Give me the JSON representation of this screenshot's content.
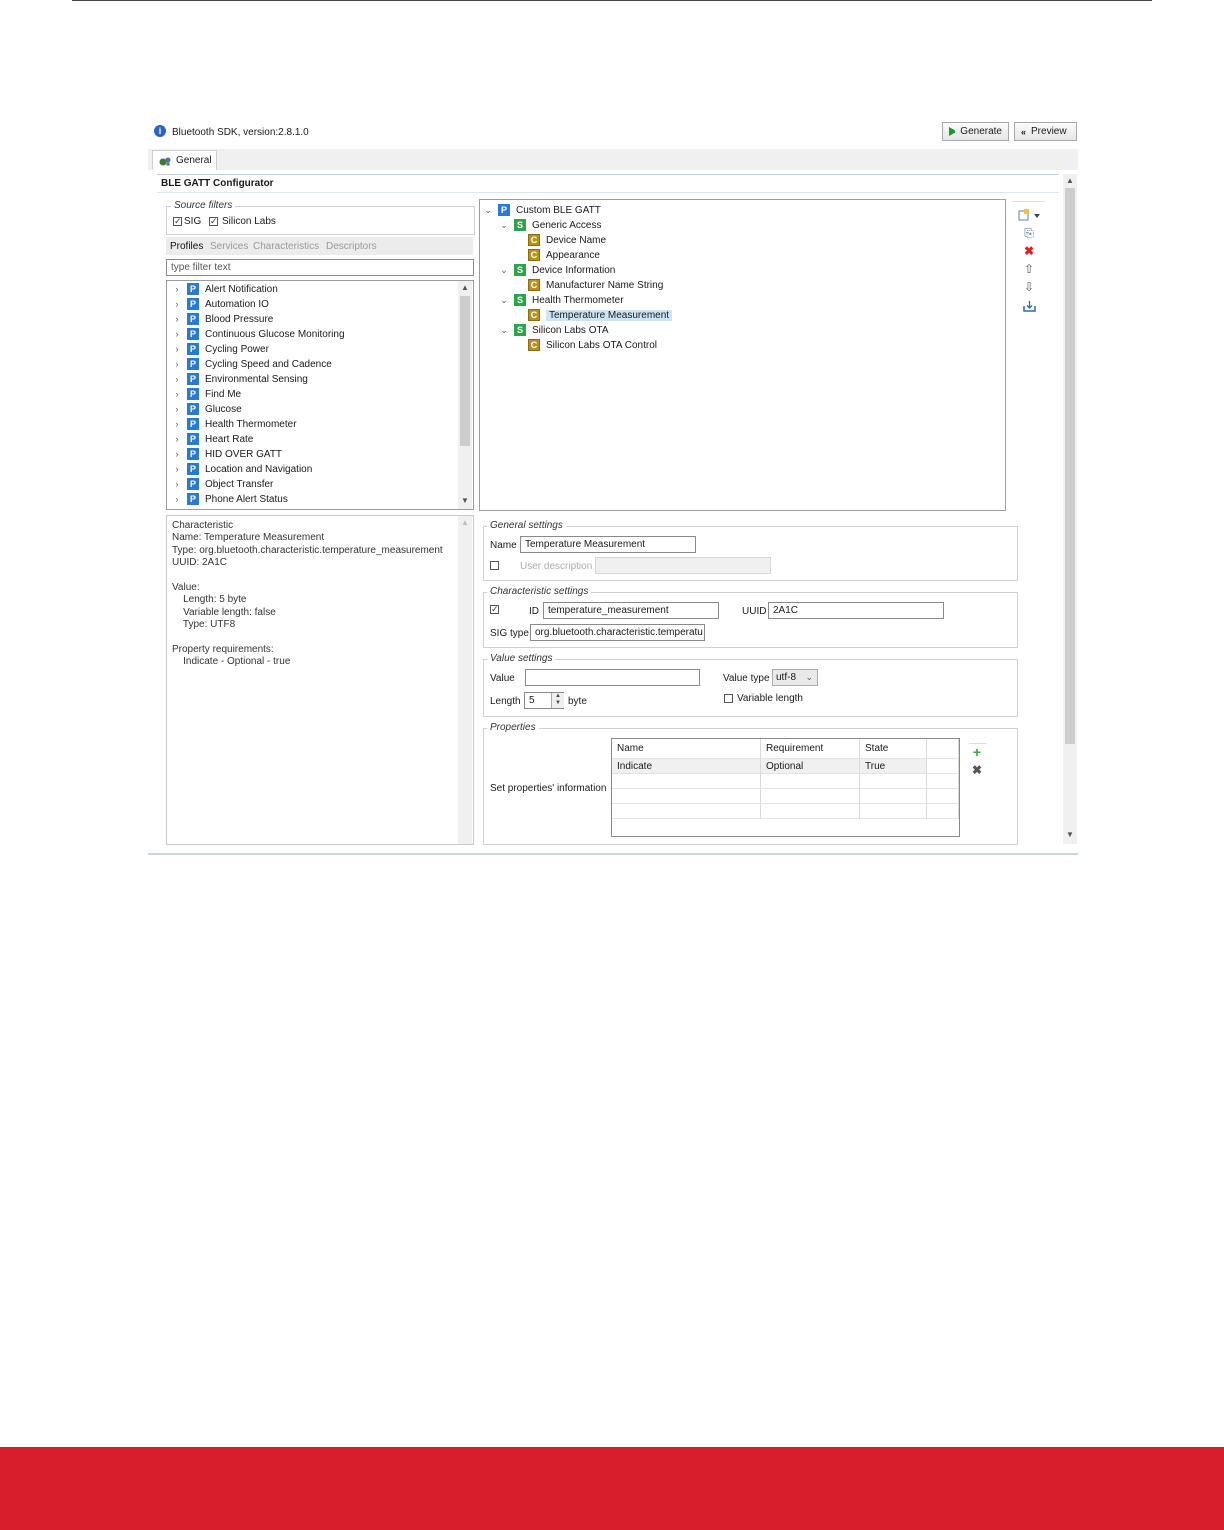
{
  "app": {
    "sdk_label": "Bluetooth SDK, version:2.8.1.0",
    "generate_label": "Generate",
    "preview_label": "Preview",
    "tab_general": "General",
    "section_title": "BLE GATT Configurator"
  },
  "source_filters": {
    "legend": "Source filters",
    "sig_label": "SIG",
    "silabs_label": "Silicon Labs"
  },
  "lib_tabs": [
    "Profiles",
    "Services",
    "Characteristics",
    "Descriptors"
  ],
  "filter": {
    "placeholder": "type filter text"
  },
  "profiles": [
    "Alert Notification",
    "Automation IO",
    "Blood Pressure",
    "Continuous Glucose Monitoring",
    "Cycling Power",
    "Cycling Speed and Cadence",
    "Environmental Sensing",
    "Find Me",
    "Glucose",
    "Health Thermometer",
    "Heart Rate",
    "HID OVER GATT",
    "Location and Navigation",
    "Object Transfer",
    "Phone Alert Status"
  ],
  "profile_badge": "P",
  "gatt_tree": {
    "root": "Custom BLE GATT",
    "nodes": [
      {
        "type": "S",
        "label": "Generic Access",
        "level": 1
      },
      {
        "type": "C",
        "label": "Device Name",
        "level": 2
      },
      {
        "type": "C",
        "label": "Appearance",
        "level": 2
      },
      {
        "type": "S",
        "label": "Device Information",
        "level": 1
      },
      {
        "type": "C",
        "label": "Manufacturer Name String",
        "level": 2
      },
      {
        "type": "S",
        "label": "Health Thermometer",
        "level": 1
      },
      {
        "type": "C",
        "label": "Temperature Measurement",
        "level": 2,
        "selected": true
      },
      {
        "type": "S",
        "label": "Silicon Labs OTA",
        "level": 1
      },
      {
        "type": "C",
        "label": "Silicon Labs OTA Control",
        "level": 2
      }
    ]
  },
  "info": {
    "lines": [
      "Characteristic",
      "Name: Temperature Measurement",
      "Type: org.bluetooth.characteristic.temperature_measurement",
      "UUID: 2A1C",
      "",
      "Value:",
      "    Length: 5 byte",
      "    Variable length: false",
      "    Type: UTF8",
      "",
      "Property requirements:",
      "    Indicate - Optional - true"
    ]
  },
  "general_settings": {
    "legend": "General settings",
    "name_label": "Name",
    "name_value": "Temperature Measurement",
    "user_desc_label": "User description"
  },
  "characteristic_settings": {
    "legend": "Characteristic settings",
    "id_label": "ID",
    "id_value": "temperature_measurement",
    "uuid_label": "UUID",
    "uuid_value": "2A1C",
    "sigtype_label": "SIG type",
    "sigtype_value": "org.bluetooth.characteristic.temperatu"
  },
  "value_settings": {
    "legend": "Value settings",
    "value_label": "Value",
    "value_value": "",
    "value_type_label": "Value type",
    "value_type_selected": "utf-8",
    "length_label": "Length",
    "length_value": "5",
    "byte_label": "byte",
    "variable_length_label": "Variable length"
  },
  "properties": {
    "legend": "Properties",
    "side_label": "Set properties' information",
    "columns": [
      "Name",
      "Requirement",
      "State"
    ],
    "rows": [
      [
        "Indicate",
        "Optional",
        "True"
      ]
    ]
  },
  "colors": {
    "footer_red": "#d81e2c",
    "selection": "#cce4f7",
    "badge_profile": "#2a7ad2",
    "badge_service": "#2aa54a",
    "badge_char": "#b8921e",
    "delete_red": "#e02020",
    "add_green": "#3aa33a"
  }
}
